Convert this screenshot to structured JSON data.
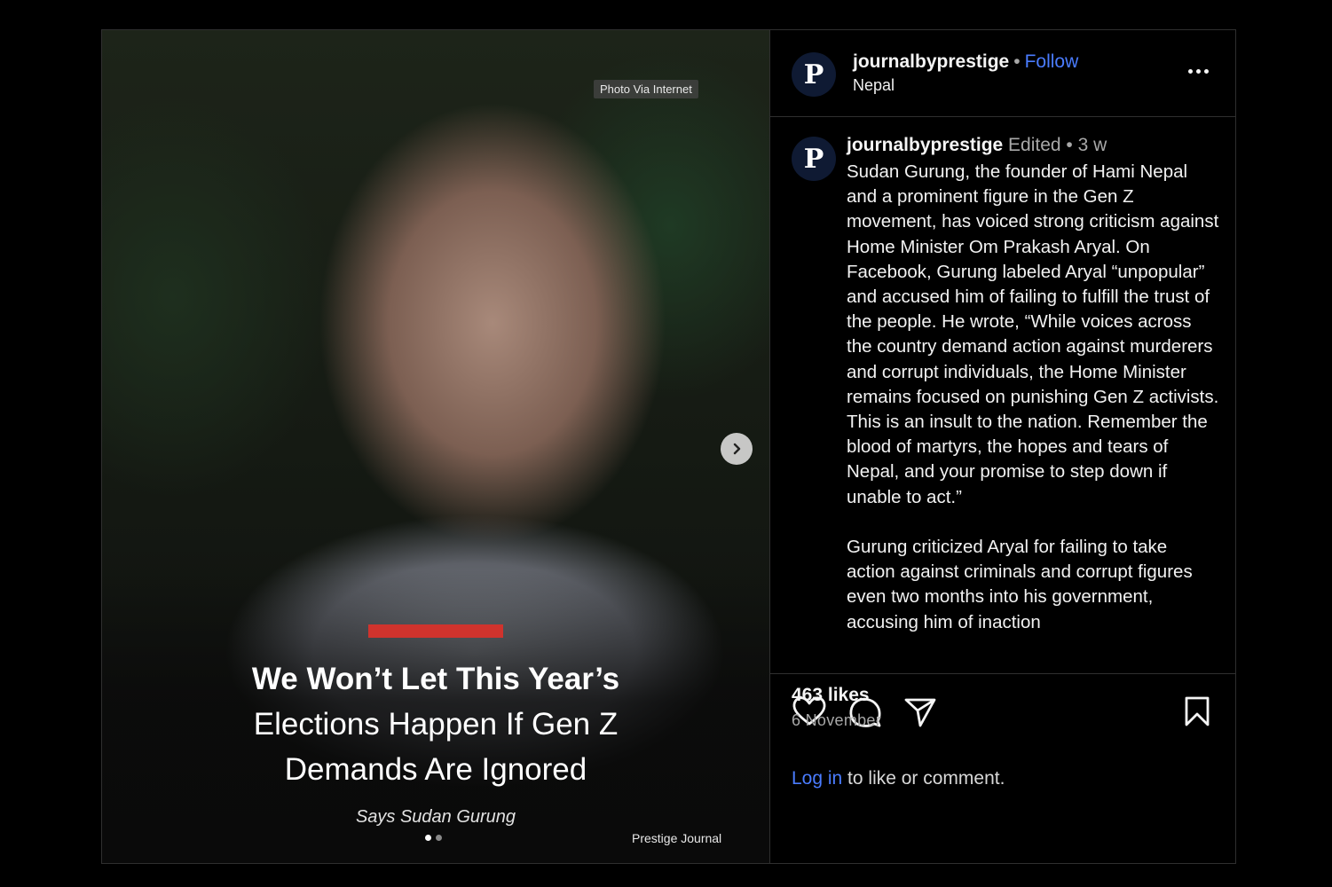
{
  "post": {
    "photo_credit": "Photo Via Internet",
    "headline_bold": "We Won’t Let This Year’s",
    "headline_rest_1": "Elections Happen If Gen Z",
    "headline_rest_2": "Demands Are Ignored",
    "says": "Says Sudan Gurung",
    "brand": "Prestige Journal",
    "carousel": {
      "count": 2,
      "active": 1
    }
  },
  "header": {
    "avatar_letter": "P",
    "username": "journalbyprestige",
    "separator": "•",
    "follow": "Follow",
    "location": "Nepal"
  },
  "caption": {
    "avatar_letter": "P",
    "username": "journalbyprestige",
    "meta": "Edited •  3 w",
    "body": "Sudan Gurung, the founder of Hami Nepal and a prominent figure in the Gen Z movement, has voiced strong criticism against Home Minister Om Prakash Aryal. On Facebook, Gurung labeled Aryal “unpopular” and accused him of failing to fulfill the trust of the people. He wrote, “While voices across the country demand action against murderers and corrupt individuals, the Home Minister remains focused on punishing Gen Z activists. This is an insult to the nation. Remember the blood of martyrs, the hopes and tears of Nepal, and your promise to step down if unable to act.”\n\nGurung criticized Aryal for failing to take action against criminals and corrupt figures even two months into his government, accusing him of inaction"
  },
  "stats": {
    "likes": "463 likes",
    "date": "6 November"
  },
  "footer": {
    "login_link": "Log in",
    "login_rest": " to like or comment."
  },
  "icons": [
    "heart-icon",
    "comment-icon",
    "share-icon",
    "bookmark-icon",
    "more-icon",
    "chevron-right-icon"
  ],
  "colors": {
    "accent": "#4a7cff",
    "red_bar": "#d0332d",
    "background": "#000000"
  }
}
